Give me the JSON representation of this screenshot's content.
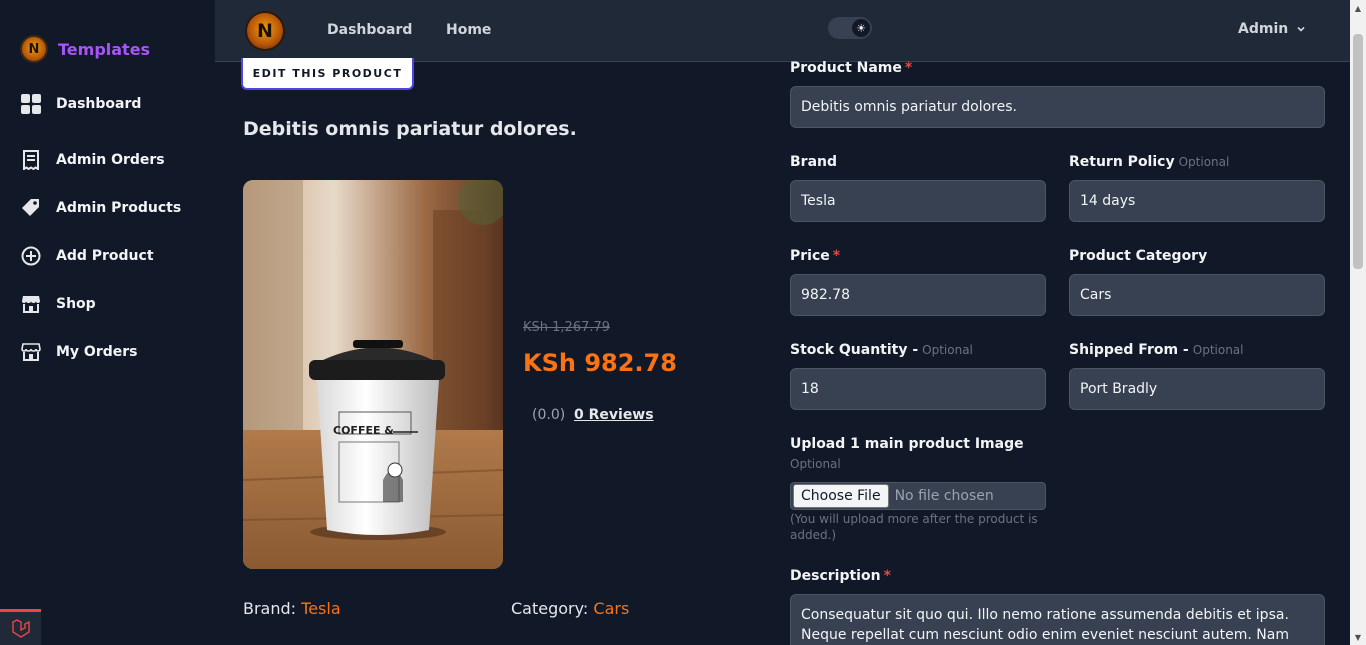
{
  "sidebar": {
    "brand": "Templates",
    "brand_logo_letter": "N",
    "items": [
      {
        "label": "Dashboard",
        "icon": "grid-icon"
      },
      {
        "label": "Admin Orders",
        "icon": "receipt-icon"
      },
      {
        "label": "Admin Products",
        "icon": "tag-icon"
      },
      {
        "label": "Add Product",
        "icon": "plus-circle-icon"
      },
      {
        "label": "Shop",
        "icon": "store-icon"
      },
      {
        "label": "My Orders",
        "icon": "store-icon"
      }
    ]
  },
  "topbar": {
    "logo_letter": "N",
    "links": [
      "Dashboard",
      "Home"
    ],
    "theme_toggle_symbol": "☀",
    "user_menu": "Admin"
  },
  "product": {
    "edit_button": "EDIT THIS PRODUCT",
    "title": "Debitis omnis pariatur dolores.",
    "old_price": "KSh 1,267.79",
    "price": "KSh 982.78",
    "rating": "(0.0)",
    "reviews": "0 Reviews",
    "brand_label": "Brand:",
    "brand_value": "Tesla",
    "category_label": "Category:",
    "category_value": "Cars"
  },
  "form": {
    "product_name_label": "Product Name",
    "product_name_value": "Debitis omnis pariatur dolores.",
    "brand_label": "Brand",
    "brand_value": "Tesla",
    "return_policy_label": "Return Policy",
    "return_policy_optional": "Optional",
    "return_policy_value": "14 days",
    "price_label": "Price",
    "price_value": "982.78",
    "category_label": "Product Category",
    "category_value": "Cars",
    "stock_label": "Stock Quantity -",
    "stock_optional": "Optional",
    "stock_value": "18",
    "shipped_label": "Shipped From -",
    "shipped_optional": "Optional",
    "shipped_value": "Port Bradly",
    "upload_label": "Upload 1 main product Image",
    "upload_optional": "Optional",
    "choose_file": "Choose File",
    "no_file": "No file chosen",
    "upload_note": "(You will upload more after the product is added.)",
    "description_label": "Description",
    "description_value": "Consequatur sit quo qui. Illo nemo ratione assumenda debitis et ipsa. Neque repellat cum nesciunt odio enim eveniet nesciunt autem. Nam",
    "required_mark": "*"
  },
  "colors": {
    "accent_purple": "#a855f7",
    "price_orange": "#f97316",
    "required_red": "#ef4444",
    "background": "#111827"
  }
}
